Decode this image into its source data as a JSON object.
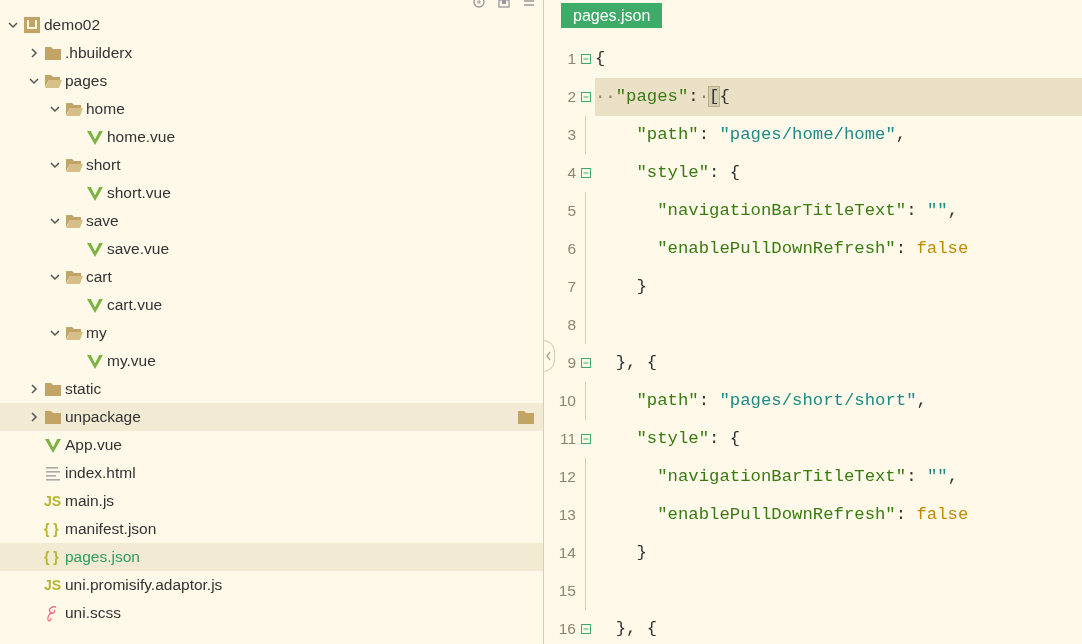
{
  "sidebar": {
    "tree": [
      {
        "label": "demo02",
        "kind": "project",
        "expanded": true,
        "selected": false,
        "hovered": false,
        "children": [
          {
            "label": ".hbuilderx",
            "kind": "folder",
            "expanded": false,
            "selected": false,
            "hovered": false
          },
          {
            "label": "pages",
            "kind": "folder",
            "expanded": true,
            "selected": false,
            "hovered": false,
            "children": [
              {
                "label": "home",
                "kind": "folder",
                "expanded": true,
                "selected": false,
                "hovered": false,
                "children": [
                  {
                    "label": "home.vue",
                    "kind": "vue",
                    "selected": false,
                    "hovered": false
                  }
                ]
              },
              {
                "label": "short",
                "kind": "folder",
                "expanded": true,
                "selected": false,
                "hovered": false,
                "children": [
                  {
                    "label": "short.vue",
                    "kind": "vue",
                    "selected": false,
                    "hovered": false
                  }
                ]
              },
              {
                "label": "save",
                "kind": "folder",
                "expanded": true,
                "selected": false,
                "hovered": false,
                "children": [
                  {
                    "label": "save.vue",
                    "kind": "vue",
                    "selected": false,
                    "hovered": false
                  }
                ]
              },
              {
                "label": "cart",
                "kind": "folder",
                "expanded": true,
                "selected": false,
                "hovered": false,
                "children": [
                  {
                    "label": "cart.vue",
                    "kind": "vue",
                    "selected": false,
                    "hovered": false
                  }
                ]
              },
              {
                "label": "my",
                "kind": "folder",
                "expanded": true,
                "selected": false,
                "hovered": false,
                "children": [
                  {
                    "label": "my.vue",
                    "kind": "vue",
                    "selected": false,
                    "hovered": false
                  }
                ]
              }
            ]
          },
          {
            "label": "static",
            "kind": "folder",
            "expanded": false,
            "selected": false,
            "hovered": false
          },
          {
            "label": "unpackage",
            "kind": "folder",
            "expanded": false,
            "selected": false,
            "hovered": true
          },
          {
            "label": "App.vue",
            "kind": "vue",
            "selected": false,
            "hovered": false
          },
          {
            "label": "index.html",
            "kind": "html",
            "selected": false,
            "hovered": false
          },
          {
            "label": "main.js",
            "kind": "js",
            "icon_text": "JS",
            "selected": false,
            "hovered": false
          },
          {
            "label": "manifest.json",
            "kind": "json",
            "icon_text": "{ }",
            "selected": false,
            "hovered": false
          },
          {
            "label": "pages.json",
            "kind": "json",
            "icon_text": "{ }",
            "selected": true,
            "hovered": false
          },
          {
            "label": "uni.promisify.adaptor.js",
            "kind": "js",
            "icon_text": "JS",
            "selected": false,
            "hovered": false
          },
          {
            "label": "uni.scss",
            "kind": "scss",
            "selected": false,
            "hovered": false
          }
        ]
      }
    ]
  },
  "editor": {
    "tabs": [
      {
        "label": "pages.json",
        "selected": true
      }
    ],
    "lines": [
      {
        "number": "1",
        "fold": true,
        "current": false,
        "tokens": [
          {
            "kind": "punct",
            "text": "{"
          }
        ]
      },
      {
        "number": "2",
        "fold": true,
        "current": true,
        "tokens": [
          {
            "kind": "whitespace",
            "text": "··"
          },
          {
            "kind": "key",
            "text": "\"pages\""
          },
          {
            "kind": "punct",
            "text": ":"
          },
          {
            "kind": "whitespace",
            "text": "·"
          },
          {
            "kind": "bracket-match",
            "text": "["
          },
          {
            "kind": "punct",
            "text": "{"
          }
        ]
      },
      {
        "number": "3",
        "fold": false,
        "current": false,
        "tokens": [
          {
            "kind": "key",
            "text": "    \"path\""
          },
          {
            "kind": "punct",
            "text": ": "
          },
          {
            "kind": "string",
            "text": "\"pages/home/home\""
          },
          {
            "kind": "punct",
            "text": ","
          }
        ]
      },
      {
        "number": "4",
        "fold": true,
        "current": false,
        "tokens": [
          {
            "kind": "key",
            "text": "    \"style\""
          },
          {
            "kind": "punct",
            "text": ": {"
          }
        ]
      },
      {
        "number": "5",
        "fold": false,
        "current": false,
        "tokens": [
          {
            "kind": "key",
            "text": "      \"navigationBarTitleText\""
          },
          {
            "kind": "punct",
            "text": ": "
          },
          {
            "kind": "string",
            "text": "\"\""
          },
          {
            "kind": "punct",
            "text": ","
          }
        ]
      },
      {
        "number": "6",
        "fold": false,
        "current": false,
        "tokens": [
          {
            "kind": "key",
            "text": "      \"enablePullDownRefresh\""
          },
          {
            "kind": "punct",
            "text": ": "
          },
          {
            "kind": "keyword",
            "text": "false"
          }
        ]
      },
      {
        "number": "7",
        "fold": false,
        "current": false,
        "tokens": [
          {
            "kind": "punct",
            "text": "    }"
          }
        ]
      },
      {
        "number": "8",
        "fold": false,
        "current": false
      },
      {
        "number": "9",
        "fold": true,
        "current": false,
        "tokens": [
          {
            "kind": "punct",
            "text": "  }, {"
          }
        ]
      },
      {
        "number": "10",
        "fold": false,
        "current": false,
        "tokens": [
          {
            "kind": "key",
            "text": "    \"path\""
          },
          {
            "kind": "punct",
            "text": ": "
          },
          {
            "kind": "string",
            "text": "\"pages/short/short\""
          },
          {
            "kind": "punct",
            "text": ","
          }
        ]
      },
      {
        "number": "11",
        "fold": true,
        "current": false,
        "tokens": [
          {
            "kind": "key",
            "text": "    \"style\""
          },
          {
            "kind": "punct",
            "text": ": {"
          }
        ]
      },
      {
        "number": "12",
        "fold": false,
        "current": false,
        "tokens": [
          {
            "kind": "key",
            "text": "      \"navigationBarTitleText\""
          },
          {
            "kind": "punct",
            "text": ": "
          },
          {
            "kind": "string",
            "text": "\"\""
          },
          {
            "kind": "punct",
            "text": ","
          }
        ]
      },
      {
        "number": "13",
        "fold": false,
        "current": false,
        "tokens": [
          {
            "kind": "key",
            "text": "      \"enablePullDownRefresh\""
          },
          {
            "kind": "punct",
            "text": ": "
          },
          {
            "kind": "keyword",
            "text": "false"
          }
        ]
      },
      {
        "number": "14",
        "fold": false,
        "current": false,
        "tokens": [
          {
            "kind": "punct",
            "text": "    }"
          }
        ]
      },
      {
        "number": "15",
        "fold": false,
        "current": false
      },
      {
        "number": "16",
        "fold": true,
        "current": false,
        "tokens": [
          {
            "kind": "punct",
            "text": "  }, {"
          }
        ]
      }
    ]
  }
}
